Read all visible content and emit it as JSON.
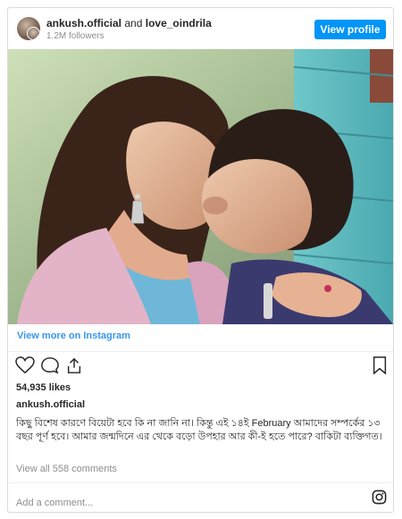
{
  "header": {
    "username": "ankush.official",
    "connector": " and ",
    "coauthor": "love_oindrila",
    "followers": "1.2M followers",
    "view_profile_label": "View profile"
  },
  "photo": {
    "alt": "Couple kissing in front of a blue wooden wall"
  },
  "view_more_label": "View more on Instagram",
  "actions": {
    "like_icon": "heart-icon",
    "comment_icon": "comment-icon",
    "share_icon": "share-icon",
    "save_icon": "bookmark-icon"
  },
  "likes": "54,935 likes",
  "post": {
    "username": "ankush.official",
    "caption": "কিছু বিশেষ কারণে বিয়েটা হবে কি না জানি না। কিন্তু এই ১৪ই February আমাদের সম্পর্কের ১৩ বছর পূর্ণ হবে। আমার জন্মদিনে এর থেকে বড়ো উপহার আর কী-ই হতে পারে? বাকিটা ব্যক্তিগত।"
  },
  "view_comments_label": "View all 558 comments",
  "add_comment_placeholder": "Add a comment...",
  "colors": {
    "accent": "#0095f6",
    "link": "#3897f0",
    "muted": "#8e8e8e"
  }
}
